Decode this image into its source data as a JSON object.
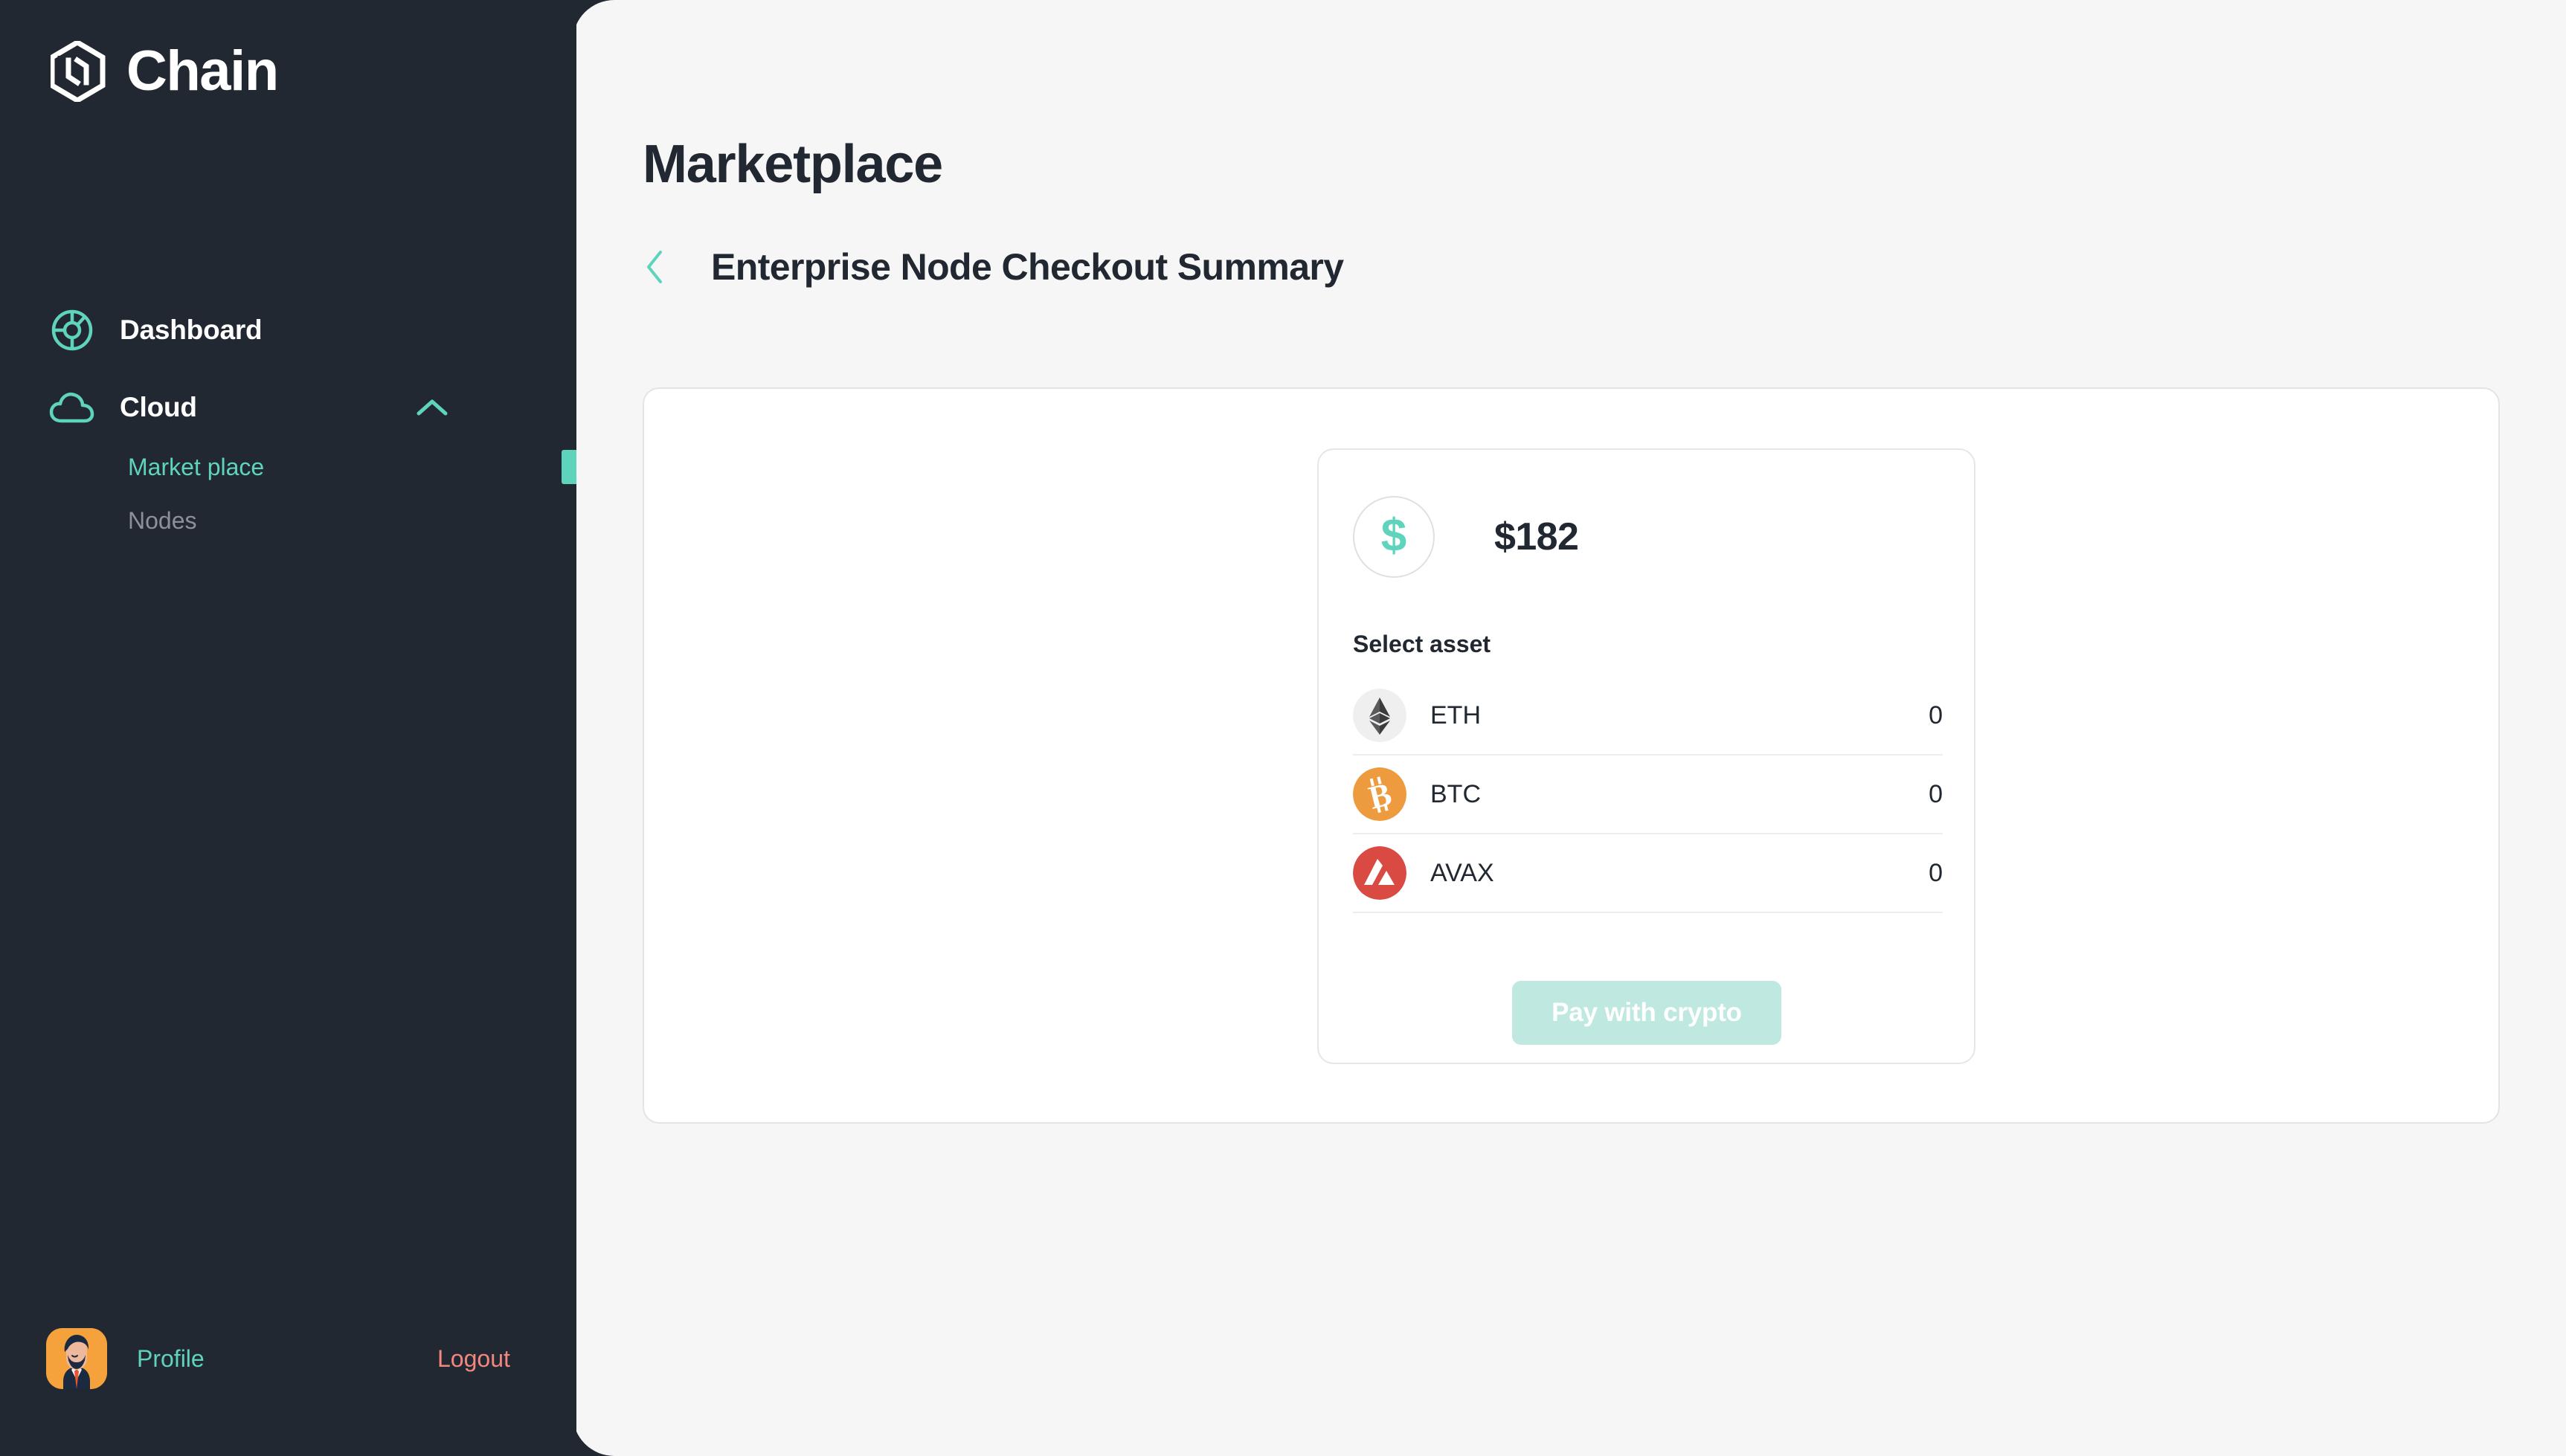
{
  "brand": {
    "name": "Chain",
    "logo_icon": "chain-hexagon-logo"
  },
  "sidebar": {
    "nav": [
      {
        "label": "Dashboard",
        "icon": "pie-chart-icon"
      },
      {
        "label": "Cloud",
        "icon": "cloud-icon",
        "caret": "chevron-up-icon"
      }
    ],
    "subnav": [
      {
        "label": "Market place",
        "active": true
      },
      {
        "label": "Nodes",
        "active": false
      }
    ],
    "footer": {
      "profile_label": "Profile",
      "logout_label": "Logout",
      "avatar_icon": "user-avatar"
    }
  },
  "header": {
    "title": "Marketplace",
    "back_icon": "chevron-left-icon",
    "subtitle": "Enterprise Node Checkout Summary"
  },
  "checkout": {
    "currency_icon": "dollar-sign-icon",
    "amount": "$182",
    "select_asset_label": "Select asset",
    "assets": [
      {
        "symbol": "ETH",
        "amount": "0",
        "icon": "ethereum-icon"
      },
      {
        "symbol": "BTC",
        "amount": "0",
        "icon": "bitcoin-icon"
      },
      {
        "symbol": "AVAX",
        "amount": "0",
        "icon": "avalanche-icon"
      }
    ],
    "pay_button_label": "Pay with crypto",
    "pay_button_enabled": false
  },
  "colors": {
    "sidebar_bg": "#222831",
    "content_bg": "#F6F6F6",
    "accent_teal": "#5FD4BC",
    "accent_teal_muted": "#BEE8E0",
    "logout_red": "#F2877F",
    "eth": "#3C3C3D",
    "btc": "#EE9A3F",
    "avax": "#D94A43",
    "avatar_orange": "#F5A23D"
  }
}
